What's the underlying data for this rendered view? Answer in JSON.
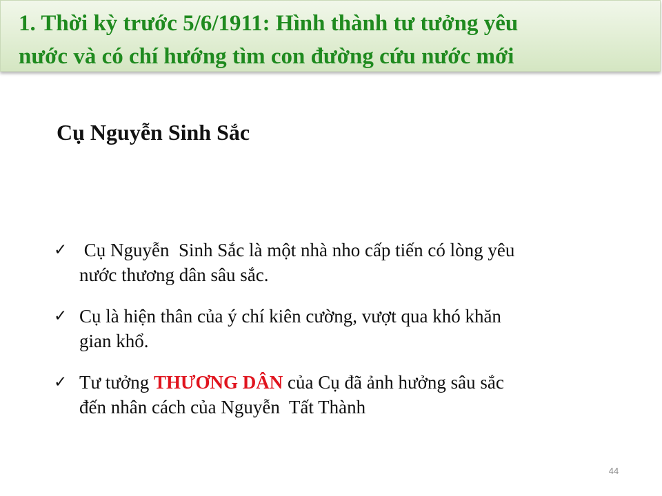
{
  "slide": {
    "title_line_1": "1. Thời kỳ trước 5/6/1911: Hình thành tư tưởng yêu",
    "title_line_2": "nước và có chí hướng tìm con đường cứu nước mới",
    "subtitle": "Cụ Nguyễn Sinh Sắc",
    "bullet_icon": "checkmark-icon",
    "check_glyph": "✓",
    "bullets": [
      {
        "line_1": " Cụ Nguyễn  Sinh Sắc là một nhà nho cấp tiến có lòng yêu",
        "line_2": "nước thương dân sâu sắc."
      },
      {
        "line_1": "Cụ là hiện thân của ý chí kiên cường, vượt qua khó khăn",
        "line_2": "gian khổ."
      },
      {
        "line_1_before": "Tư tưởng ",
        "line_1_emphasis": "THƯƠNG DÂN",
        "line_1_after": " của Cụ đã ảnh hưởng sâu sắc",
        "line_2": "đến nhân cách của Nguyễn  Tất Thành"
      }
    ],
    "page_number": "44"
  },
  "colors": {
    "title_text": "#1f8a1f",
    "banner_background": "#e3efd6",
    "emphasis_text": "#e0141e",
    "body_text": "#111111",
    "page_number_text": "#8c8c8c"
  }
}
